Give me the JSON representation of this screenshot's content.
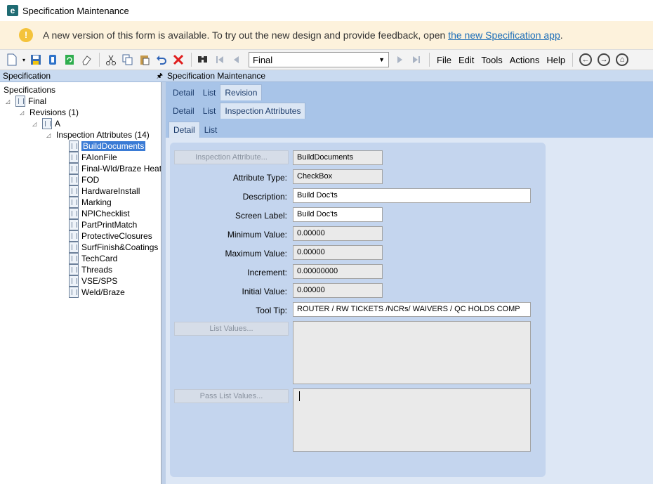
{
  "window": {
    "title": "Specification Maintenance",
    "app_icon_letter": "e"
  },
  "banner": {
    "message": "A new version of this form is available. To try out the new design and provide feedback, open ",
    "link_text": "the new Specification app",
    "link_suffix": ".",
    "icon": "warning-icon"
  },
  "toolbar": {
    "combo_value": "Final",
    "menus": [
      "File",
      "Edit",
      "Tools",
      "Actions",
      "Help"
    ]
  },
  "left_panel": {
    "title": "Specification",
    "pin_glyph": "🖈",
    "tree": {
      "root": "Specifications",
      "final": "Final",
      "revisions": "Revisions (1)",
      "rev_a": "A",
      "inspection": "Inspection Attributes (14)",
      "items": [
        "BuildDocuments",
        "FAIonFile",
        "Final-Wld/Braze Heat",
        "FOD",
        "HardwareInstall",
        "Marking",
        "NPIChecklist",
        "PartPrintMatch",
        "ProtectiveClosures",
        "SurfFinish&Coatings",
        "TechCard",
        "Threads",
        "VSE/SPS",
        "Weld/Braze"
      ]
    }
  },
  "right_panel": {
    "title": "Specification Maintenance",
    "tabs1": [
      "Detail",
      "List",
      "Revision"
    ],
    "tabs2": [
      "Detail",
      "List",
      "Inspection Attributes"
    ],
    "tabs3": [
      "Detail",
      "List"
    ]
  },
  "form": {
    "inspection_attribute_button": "Inspection Attribute...",
    "inspection_attribute_value": "BuildDocuments",
    "attribute_type_label": "Attribute Type:",
    "attribute_type_value": "CheckBox",
    "description_label": "Description:",
    "description_value": "Build Doc'ts",
    "screen_label_label": "Screen Label:",
    "screen_label_value": "Build Doc'ts",
    "min_label": "Minimum Value:",
    "min_value": "0.00000",
    "max_label": "Maximum Value:",
    "max_value": "0.00000",
    "increment_label": "Increment:",
    "increment_value": "0.00000000",
    "initial_label": "Initial Value:",
    "initial_value": "0.00000",
    "tooltip_label": "Tool Tip:",
    "tooltip_value": "ROUTER / RW TICKETS /NCRs/ WAIVERS / QC HOLDS COMP",
    "list_values_button": "List Values...",
    "pass_list_values_button": "Pass List Values..."
  }
}
